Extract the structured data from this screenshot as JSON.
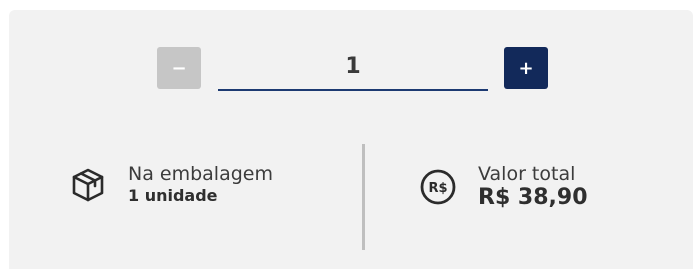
{
  "stepper": {
    "minus_label": "−",
    "plus_label": "+",
    "quantity": "1"
  },
  "package": {
    "icon": "package-box-icon",
    "label": "Na embalagem",
    "value": "1 unidade"
  },
  "total": {
    "icon": "currency-real-icon",
    "label": "Valor total",
    "value": "R$ 38,90"
  },
  "colors": {
    "card_background": "#f2f2f2",
    "minus_button": "#c6c6c6",
    "plus_button": "#12295a",
    "underline": "#1d3a72",
    "divider": "#bfbfbf"
  }
}
